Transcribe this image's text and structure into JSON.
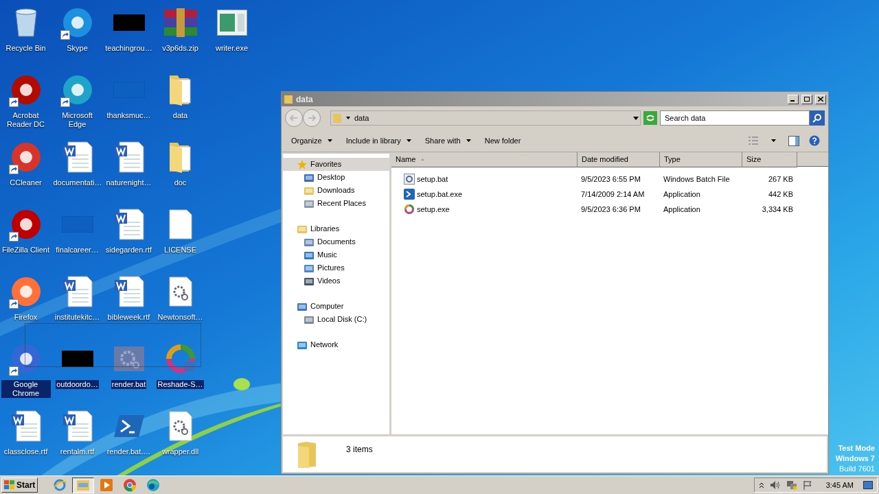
{
  "desktop": {
    "rows": [
      [
        {
          "label": "Recycle Bin",
          "kind": "bin",
          "shortcut": false,
          "selected": false
        },
        {
          "label": "Skype",
          "kind": "app",
          "color": "#1e90e0",
          "shortcut": true,
          "selected": false
        },
        {
          "label": "teachingrou…",
          "kind": "dark-image",
          "shortcut": false,
          "selected": false
        },
        {
          "label": "v3p6ds.zip",
          "kind": "archive",
          "shortcut": false,
          "selected": false
        },
        {
          "label": "writer.exe",
          "kind": "window",
          "shortcut": false,
          "selected": false
        }
      ],
      [
        {
          "label": "Acrobat Reader DC",
          "kind": "app",
          "color": "#b30b00",
          "shortcut": true,
          "selected": false
        },
        {
          "label": "Microsoft Edge",
          "kind": "app",
          "color": "#1fa3c9",
          "shortcut": true,
          "selected": false
        },
        {
          "label": "thanksmuc…",
          "kind": "blue-image",
          "shortcut": false,
          "selected": false
        },
        {
          "label": "data",
          "kind": "folder",
          "shortcut": false,
          "selected": false
        }
      ],
      [
        {
          "label": "CCleaner",
          "kind": "app",
          "color": "#d8352a",
          "shortcut": true,
          "selected": false
        },
        {
          "label": "documentati…",
          "kind": "document",
          "shortcut": false,
          "selected": false
        },
        {
          "label": "naturenight…",
          "kind": "document",
          "shortcut": false,
          "selected": false
        },
        {
          "label": "doc",
          "kind": "folder",
          "shortcut": false,
          "selected": false
        }
      ],
      [
        {
          "label": "FileZilla Client",
          "kind": "app",
          "color": "#bf0000",
          "shortcut": true,
          "selected": false
        },
        {
          "label": "finalcareer…",
          "kind": "blue-image",
          "shortcut": false,
          "selected": false
        },
        {
          "label": "sidegarden.rtf",
          "kind": "document",
          "shortcut": false,
          "selected": false
        },
        {
          "label": "LICENSE",
          "kind": "blank-file",
          "shortcut": false,
          "selected": false
        }
      ],
      [
        {
          "label": "Firefox",
          "kind": "app",
          "color": "#ff7139",
          "shortcut": true,
          "selected": false
        },
        {
          "label": "institutekitc…",
          "kind": "document",
          "shortcut": false,
          "selected": false
        },
        {
          "label": "bibleweek.rtf",
          "kind": "document",
          "shortcut": false,
          "selected": false
        },
        {
          "label": "Newtonsoft…",
          "kind": "config-file",
          "shortcut": false,
          "selected": false
        }
      ],
      [
        {
          "label": "Google Chrome",
          "kind": "app",
          "color": "#3367d6",
          "shortcut": true,
          "selected": true
        },
        {
          "label": "outdoordo…",
          "kind": "dark-image",
          "shortcut": false,
          "selected": true
        },
        {
          "label": "render.bat",
          "kind": "config-window",
          "shortcut": false,
          "selected": true
        },
        {
          "label": "Reshade-S…",
          "kind": "ring",
          "shortcut": false,
          "selected": true
        }
      ],
      [
        {
          "label": "classclose.rtf",
          "kind": "document",
          "shortcut": false,
          "selected": false
        },
        {
          "label": "rentalm.rtf",
          "kind": "document",
          "shortcut": false,
          "selected": false
        },
        {
          "label": "render.bat.…",
          "kind": "script",
          "shortcut": false,
          "selected": false
        },
        {
          "label": "wrapper.dll",
          "kind": "config-file",
          "shortcut": false,
          "selected": false
        }
      ]
    ]
  },
  "explorer": {
    "title": "data",
    "address": "data",
    "search": {
      "placeholder": "Search data"
    },
    "commands": [
      "Organize",
      "Include in library",
      "Share with",
      "New folder"
    ],
    "nav": [
      {
        "label": "Favorites",
        "kind": "star",
        "selected": true,
        "children": [
          {
            "label": "Desktop",
            "kind": "desktop",
            "selected": false
          },
          {
            "label": "Downloads",
            "kind": "folder",
            "selected": false
          },
          {
            "label": "Recent Places",
            "kind": "recent",
            "selected": false
          }
        ]
      },
      {
        "label": "Libraries",
        "kind": "library",
        "selected": false,
        "children": [
          {
            "label": "Documents",
            "kind": "doc",
            "selected": false
          },
          {
            "label": "Music",
            "kind": "music",
            "selected": false
          },
          {
            "label": "Pictures",
            "kind": "pictures",
            "selected": false
          },
          {
            "label": "Videos",
            "kind": "video",
            "selected": false
          }
        ]
      },
      {
        "label": "Computer",
        "kind": "computer",
        "selected": false,
        "children": [
          {
            "label": "Local Disk (C:)",
            "kind": "disk",
            "selected": false
          }
        ]
      },
      {
        "label": "Network",
        "kind": "network",
        "selected": false
      }
    ],
    "table": {
      "columns": [
        "Name",
        "Date modified",
        "Type",
        "Size"
      ],
      "rows": [
        {
          "kind": "config",
          "cells": [
            "setup.bat",
            "9/5/2023 6:55 PM",
            "Windows Batch File",
            "267 KB"
          ]
        },
        {
          "kind": "script",
          "cells": [
            "setup.bat.exe",
            "7/14/2009 2:14 AM",
            "Application",
            "442 KB"
          ]
        },
        {
          "kind": "ring",
          "cells": [
            "setup.exe",
            "9/5/2023 6:36 PM",
            "Application",
            "3,334 KB"
          ]
        }
      ]
    },
    "status": "3 items"
  },
  "watermark_text": [
    "Test Mode",
    "Windows 7",
    "Build 7601"
  ],
  "taskbar": {
    "start": "Start",
    "apps": [
      {
        "kind": "ie",
        "selected": false
      },
      {
        "kind": "explorer",
        "selected": true
      },
      {
        "kind": "media",
        "selected": false
      },
      {
        "kind": "chrome",
        "selected": false
      },
      {
        "kind": "edge",
        "selected": false
      }
    ],
    "clock": "3:45 AM"
  }
}
